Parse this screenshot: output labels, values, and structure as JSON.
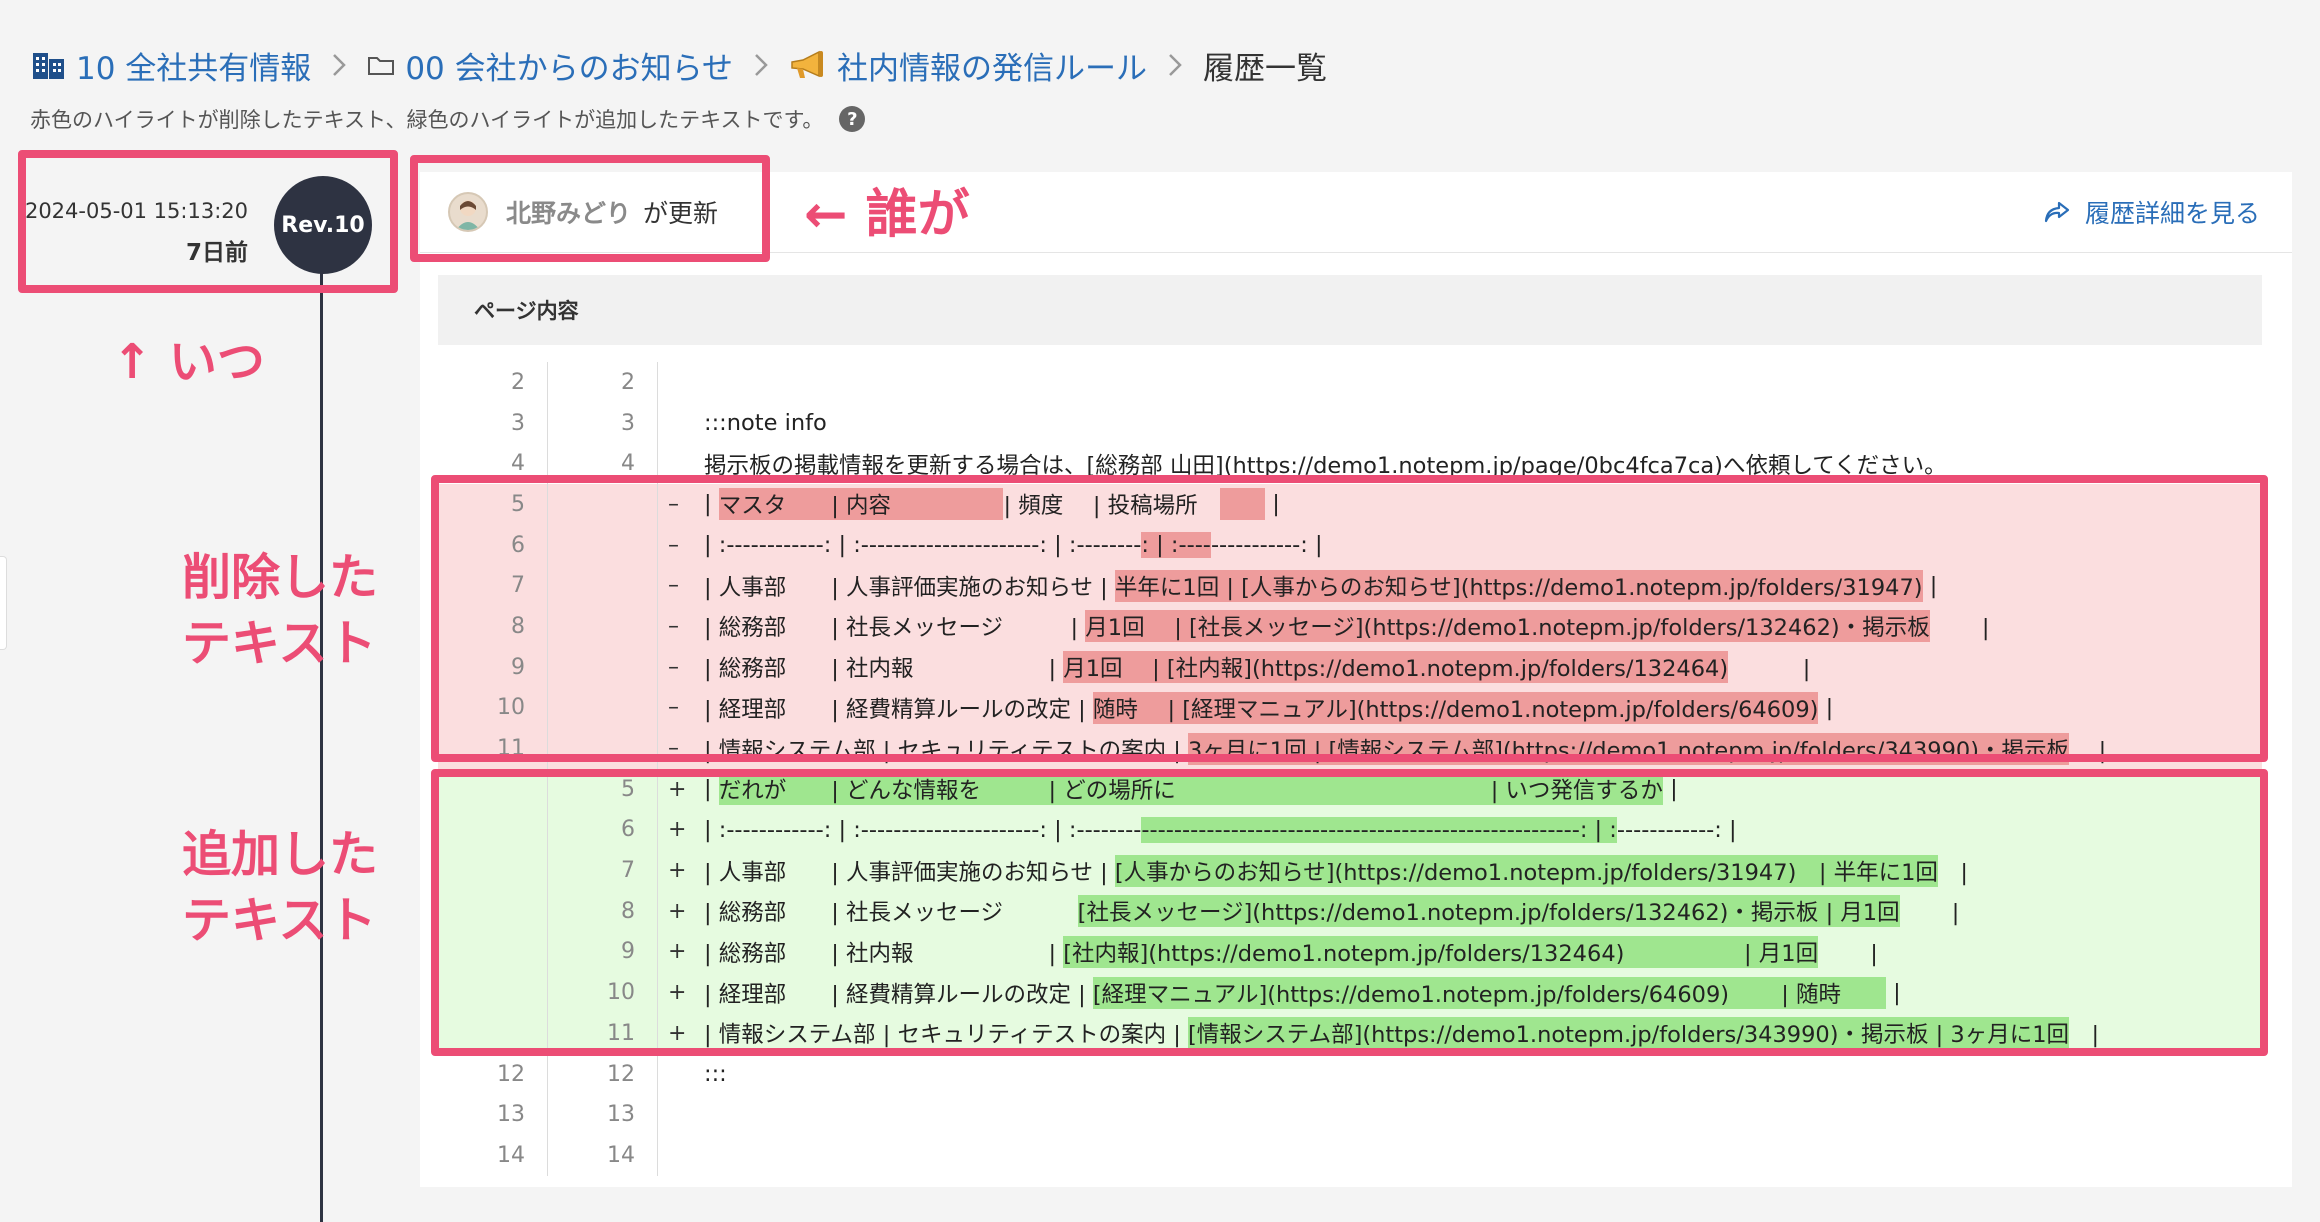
{
  "breadcrumb": {
    "items": [
      {
        "label": "10 全社共有情報",
        "icon": "building-icon"
      },
      {
        "label": "00 会社からのお知らせ",
        "icon": "folder-icon"
      },
      {
        "label": "社内情報の発信ルール",
        "icon": "megaphone-icon"
      },
      {
        "label": "履歴一覧",
        "icon": ""
      }
    ]
  },
  "subtitle": "赤色のハイライトが削除したテキスト、緑色のハイライトが追加したテキストです。",
  "help_icon": "?",
  "revision": {
    "datetime": "2024-05-01 15:13:20",
    "ago": "7日前",
    "badge": "Rev.10"
  },
  "updater": {
    "name": "北野みどり",
    "suffix": "が更新"
  },
  "history_link": "履歴詳細を見る",
  "section_title": "ページ内容",
  "annotations": {
    "who": "← 誰が",
    "when": "↑ いつ",
    "deleted_line1": "削除した",
    "deleted_line2": "テキスト",
    "added_line1": "追加した",
    "added_line2": "テキスト"
  },
  "diff_rows": [
    {
      "old": "2",
      "new": "2",
      "marker": "",
      "type": "context",
      "segments": [
        {
          "t": "",
          "h": false
        }
      ]
    },
    {
      "old": "3",
      "new": "3",
      "marker": "",
      "type": "context",
      "segments": [
        {
          "t": ":::note info",
          "h": false
        }
      ]
    },
    {
      "old": "4",
      "new": "4",
      "marker": "",
      "type": "context",
      "segments": [
        {
          "t": "掲示板の掲載情報を更新する場合は、[総務部 山田](https://demo1.notepm.jp/page/0bc4fca7ca)へ依頼してください。",
          "h": false
        }
      ]
    },
    {
      "old": "5",
      "new": "",
      "marker": "–",
      "type": "deleted",
      "segments": [
        {
          "t": "| ",
          "h": false
        },
        {
          "t": "マスタ　　| 内容　　　　　",
          "h": true
        },
        {
          "t": "| 頻度　 | 投稿場所　",
          "h": false
        },
        {
          "t": "　　",
          "h": true
        },
        {
          "t": " |",
          "h": false
        }
      ]
    },
    {
      "old": "6",
      "new": "",
      "marker": "–",
      "type": "deleted",
      "segments": [
        {
          "t": "| :------------: | :----------------------: | :--------",
          "h": false
        },
        {
          "t": ": | :----",
          "h": true
        },
        {
          "t": "-----------: |",
          "h": false
        }
      ]
    },
    {
      "old": "7",
      "new": "",
      "marker": "–",
      "type": "deleted",
      "segments": [
        {
          "t": "| 人事部　　| 人事評価実施のお知らせ | ",
          "h": false
        },
        {
          "t": "半年に1回 | [人事からのお知らせ](https://demo1.notepm.jp/folders/31947)",
          "h": true
        },
        {
          "t": " |",
          "h": false
        }
      ]
    },
    {
      "old": "8",
      "new": "",
      "marker": "–",
      "type": "deleted",
      "segments": [
        {
          "t": "| 総務部　　| 社長メッセージ　　　| ",
          "h": false
        },
        {
          "t": "月1回　 | [社長メッセージ](https://demo1.notepm.jp/folders/132462)・掲示板",
          "h": true
        },
        {
          "t": "　　 |",
          "h": false
        }
      ]
    },
    {
      "old": "9",
      "new": "",
      "marker": "–",
      "type": "deleted",
      "segments": [
        {
          "t": "| 総務部　　| 社内報　　　　　　| ",
          "h": false
        },
        {
          "t": "月1回　 | [社内報](https://demo1.notepm.jp/folders/132464)",
          "h": true
        },
        {
          "t": "　　　 |",
          "h": false
        }
      ]
    },
    {
      "old": "10",
      "new": "",
      "marker": "–",
      "type": "deleted",
      "segments": [
        {
          "t": "| 経理部　　| 経費精算ルールの改定 | ",
          "h": false
        },
        {
          "t": "随時　 | [経理マニュアル](https://demo1.notepm.jp/folders/64609)",
          "h": true
        },
        {
          "t": " |",
          "h": false
        }
      ]
    },
    {
      "old": "11",
      "new": "",
      "marker": "–",
      "type": "deleted",
      "segments": [
        {
          "t": "| 情報システム部 | セキュリティテストの案内 | ",
          "h": false
        },
        {
          "t": "3ヶ月に1回 | [情報システム部](https://demo1.notepm.jp/folders/343990)・掲示板",
          "h": true
        },
        {
          "t": "　 |",
          "h": false
        }
      ]
    },
    {
      "old": "",
      "new": "5",
      "marker": "+",
      "type": "added",
      "segments": [
        {
          "t": "| ",
          "h": false
        },
        {
          "t": "だれが　　| どんな情報を　　　| どの場所に　　　　　　　　　　　　　　| いつ発信するか",
          "h": true
        },
        {
          "t": " |",
          "h": false
        }
      ]
    },
    {
      "old": "",
      "new": "6",
      "marker": "+",
      "type": "added",
      "segments": [
        {
          "t": "| :------------: | :----------------------: | :--------",
          "h": false
        },
        {
          "t": "------------------------------------------------------: | :",
          "h": true
        },
        {
          "t": "------------: |",
          "h": false
        }
      ]
    },
    {
      "old": "",
      "new": "7",
      "marker": "+",
      "type": "added",
      "segments": [
        {
          "t": "| 人事部　　| 人事評価実施のお知らせ | ",
          "h": false
        },
        {
          "t": "[人事からのお知らせ](https://demo1.notepm.jp/folders/31947)　| 半年に1回",
          "h": true
        },
        {
          "t": "　|",
          "h": false
        }
      ]
    },
    {
      "old": "",
      "new": "8",
      "marker": "+",
      "type": "added",
      "segments": [
        {
          "t": "| 総務部　　| 社長メッセージ　　　 ",
          "h": false
        },
        {
          "t": "[社長メッセージ](https://demo1.notepm.jp/folders/132462)・掲示板 | 月1回",
          "h": true
        },
        {
          "t": "　　 |",
          "h": false
        }
      ]
    },
    {
      "old": "",
      "new": "9",
      "marker": "+",
      "type": "added",
      "segments": [
        {
          "t": "| 総務部　　| 社内報　　　　　　| ",
          "h": false
        },
        {
          "t": "[社内報](https://demo1.notepm.jp/folders/132464)　　　　　 | 月1回",
          "h": true
        },
        {
          "t": "　　 |",
          "h": false
        }
      ]
    },
    {
      "old": "",
      "new": "10",
      "marker": "+",
      "type": "added",
      "segments": [
        {
          "t": "| 経理部　　| 経費精算ルールの改定 | ",
          "h": false
        },
        {
          "t": "[経理マニュアル](https://demo1.notepm.jp/folders/64609)　　 | 随時　　",
          "h": true
        },
        {
          "t": " |",
          "h": false
        }
      ]
    },
    {
      "old": "",
      "new": "11",
      "marker": "+",
      "type": "added",
      "segments": [
        {
          "t": "| 情報システム部 | セキュリティテストの案内 | ",
          "h": false
        },
        {
          "t": "[情報システム部](https://demo1.notepm.jp/folders/343990)・掲示板 | 3ヶ月に1回",
          "h": true
        },
        {
          "t": "　|",
          "h": false
        }
      ]
    },
    {
      "old": "12",
      "new": "12",
      "marker": "",
      "type": "context",
      "segments": [
        {
          "t": ":::",
          "h": false
        }
      ]
    },
    {
      "old": "13",
      "new": "13",
      "marker": "",
      "type": "context",
      "segments": [
        {
          "t": "",
          "h": false
        }
      ]
    },
    {
      "old": "14",
      "new": "14",
      "marker": "",
      "type": "context",
      "segments": [
        {
          "t": "",
          "h": false
        }
      ]
    }
  ],
  "colors": {
    "annotation": "#ec4d75",
    "link": "#2a6eb8",
    "deleted_bg": "#fbdedf",
    "deleted_hl": "#ee9c9c",
    "added_bg": "#e6fbe0",
    "added_hl": "#9fe68f",
    "badge": "#2e3342"
  }
}
